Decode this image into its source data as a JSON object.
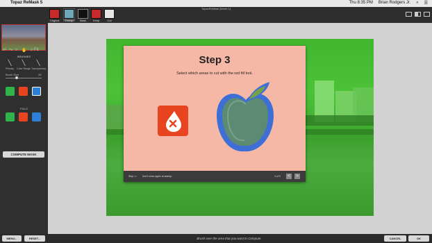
{
  "menubar": {
    "app_name": "Topaz ReMask 5",
    "clock": "Thu 8:35 PM",
    "user": "Brian Rodgers Jr."
  },
  "window": {
    "title": "TopazReMask [Mode 1]"
  },
  "tabs": [
    {
      "label": "Original",
      "color": "#c72a2a"
    },
    {
      "label": "Trimap",
      "color": "#6ea8b8"
    },
    {
      "label": "Mask",
      "color": "#111111"
    },
    {
      "label": "Keep",
      "color": "#c72a2a"
    },
    {
      "label": "Cut",
      "color": "#e6e6e6"
    }
  ],
  "left_panel": {
    "brushes_label": "BRUSHES",
    "brush_types": [
      "Primary",
      "Color Range",
      "Transparency"
    ],
    "brush_size_label": "Brush Size",
    "brush_size_value": "26",
    "fills_label": "FILLS",
    "compute_label": "COMPUTE MASK",
    "zoom_label": "Fit"
  },
  "dialog": {
    "title": "Step 3",
    "text": "Select which areas to cut with the red fill tool.",
    "skip_label": "Skip >>",
    "dont_show_label": "Don't show again at startup",
    "page_counter": "4 of 9",
    "prev_label": "<",
    "next_label": ">"
  },
  "bottom": {
    "menu_label": "MENU...",
    "reset_label": "RESET...",
    "hint": "Brush over the area that you want to Compute.",
    "cancel_label": "CANCEL",
    "ok_label": "OK"
  },
  "colors": {
    "keep_green": "#2fb34a",
    "cut_red": "#e8441f",
    "compute_blue": "#2d7fd8",
    "dialog_bg": "#f5b8a6"
  }
}
